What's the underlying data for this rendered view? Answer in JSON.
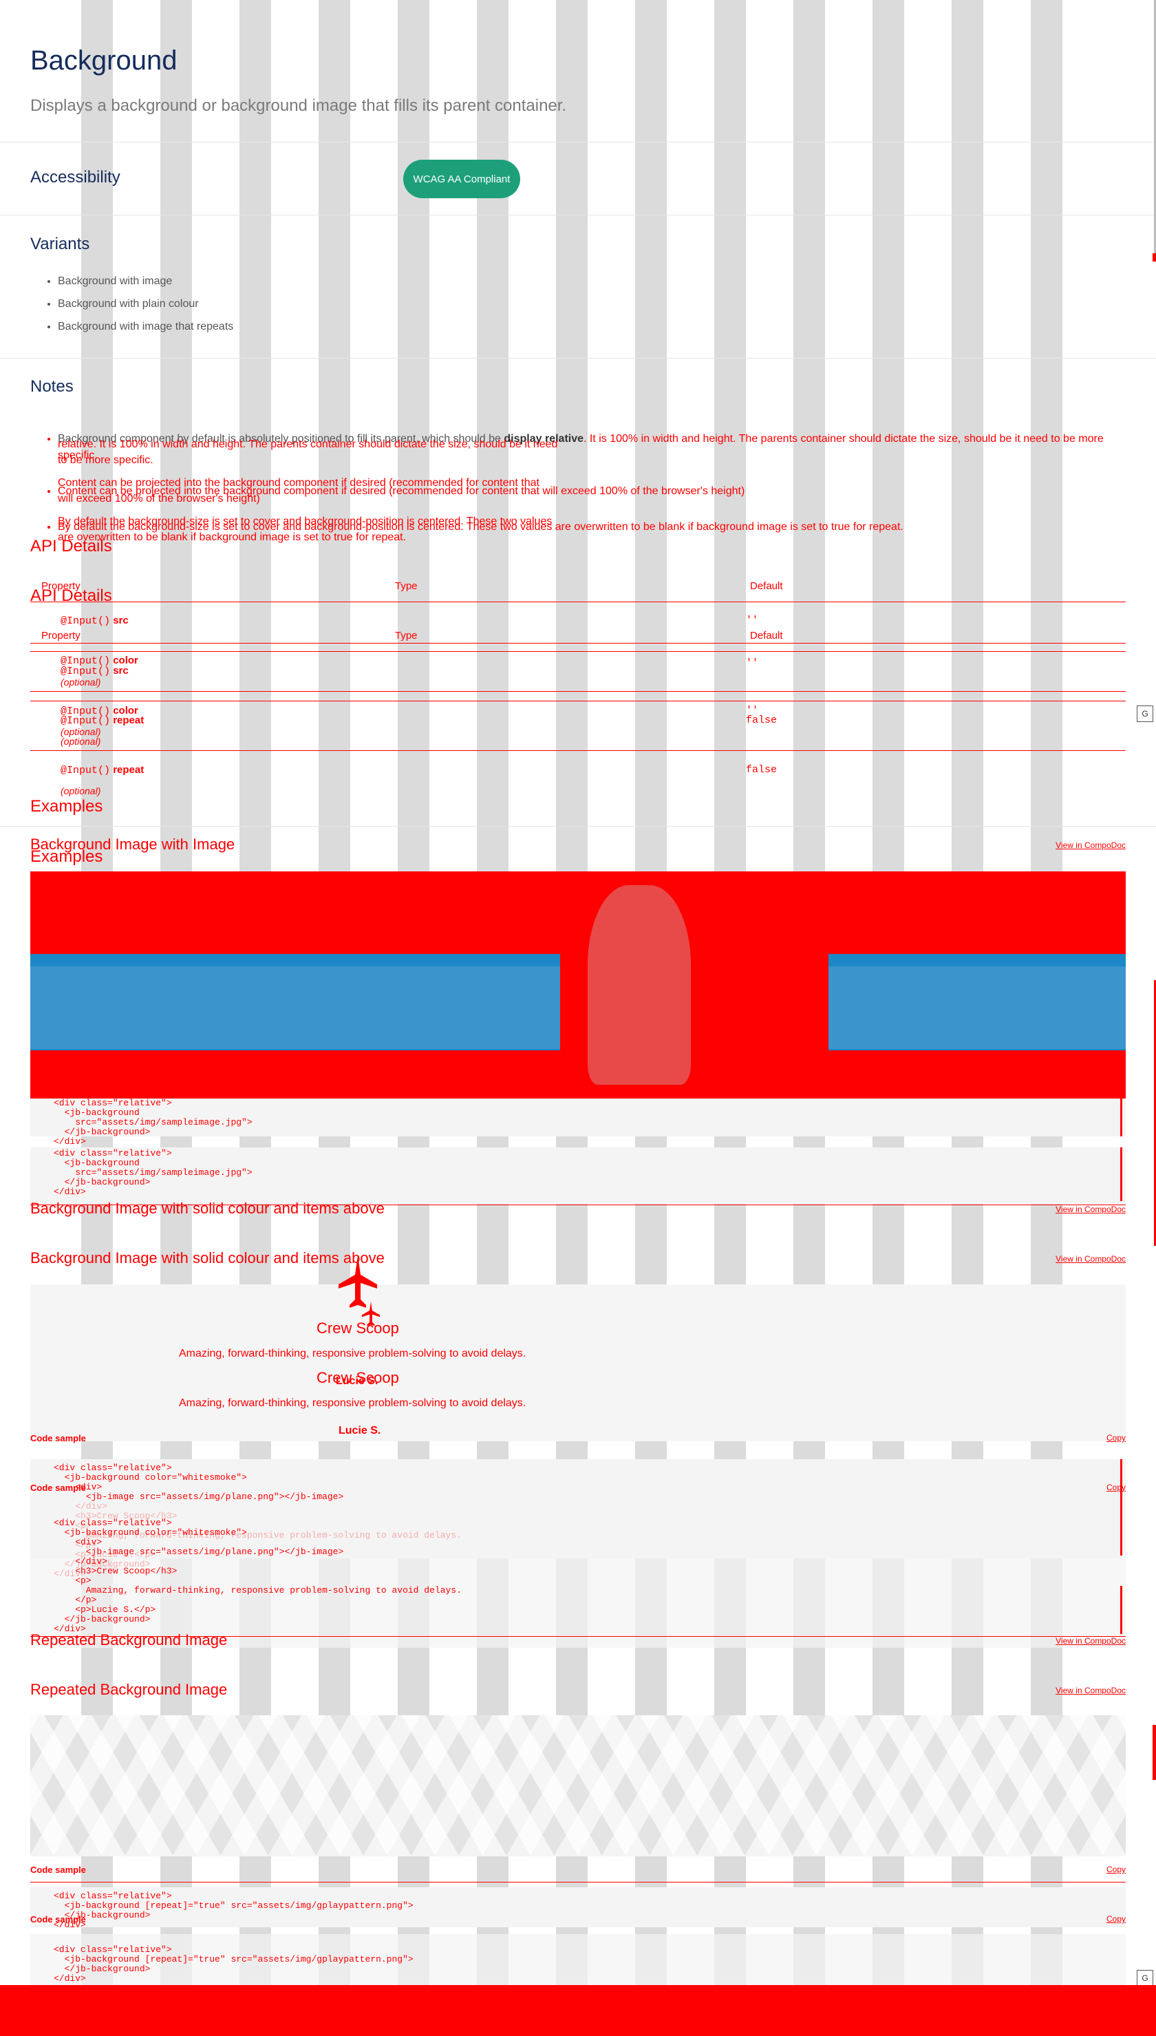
{
  "header": {
    "title": "Background",
    "subtitle": "Displays a background or background image that fills its parent container."
  },
  "accessibility": {
    "title": "Accessibility",
    "badge": "WCAG AA Compliant"
  },
  "variants": {
    "title": "Variants",
    "items": [
      "Background with image",
      "Background with plain colour",
      "Background with image that repeats"
    ]
  },
  "notes": {
    "title": "Notes",
    "items": [
      {
        "before": "Background component by default is absolutely positioned to fill its parent, which should be ",
        "strong": "display relative",
        "after": ". It is 100% in width and height. The parents container should dictate the size, should be it need to be more specific."
      },
      {
        "before": "Content can be projected into the background component if desired (recommended for content that will exceed 100% of the browser's height)",
        "strong": "",
        "after": ""
      },
      {
        "before": "By default the background-size is set to cover and background-position is centered. These two values are overwritten to be blank if background image is set to true for repeat.",
        "strong": "",
        "after": ""
      }
    ],
    "ghost_1": "relative. It is 100% in width and height. The parents container should dictate the size, should be it need",
    "ghost_2": "to be more specific.",
    "ghost_3": "Content can be projected into the background component if desired (recommended for content that",
    "ghost_4": "will exceed 100% of the browser's height)",
    "ghost_5": "By default the background-size is set to cover and background-position is centered. These two values",
    "ghost_6": "are overwritten to be blank if background image is set to true for repeat."
  },
  "api": {
    "title": "API Details",
    "col_property": "Property",
    "col_type": "Type",
    "col_default": "Default",
    "decorator": "@Input()",
    "optional": "(optional)",
    "rows": [
      {
        "name": "src",
        "default": "''"
      },
      {
        "name": "color",
        "default": "''"
      },
      {
        "name": "repeat",
        "default": "false"
      }
    ]
  },
  "examples": {
    "title": "Examples",
    "view_link": "View in CompoDoc",
    "code_label": "Code sample",
    "copy_label": "Copy",
    "ex1": {
      "title": "Background Image with Image",
      "code": "<div class=\"relative\">\n  <jb-background\n    src=\"assets/img/sampleimage.jpg\">\n  </jb-background>\n</div>"
    },
    "ex2": {
      "title": "Background Image with solid colour and items above",
      "card_title": "Crew Scoop",
      "card_text": "Amazing, forward-thinking, responsive problem-solving to avoid delays.",
      "card_author": "Lucie S.",
      "code": "<div class=\"relative\">\n  <jb-background color=\"whitesmoke\">\n    <div>\n      <jb-image src=\"assets/img/plane.png\"></jb-image>\n    </div>\n    <h3>Crew Scoop</h3>\n    <p>\n      Amazing, forward-thinking, responsive problem-solving to avoid delays.\n    </p>\n    <p>Lucie S.</p>\n  </jb-background>\n</div>"
    },
    "ex3": {
      "title": "Repeated Background Image",
      "code": "<div class=\"relative\">\n  <jb-background [repeat]=\"true\" src=\"assets/img/gplaypattern.png\">\n  </jb-background>\n</div>"
    }
  },
  "side_widget": "G"
}
